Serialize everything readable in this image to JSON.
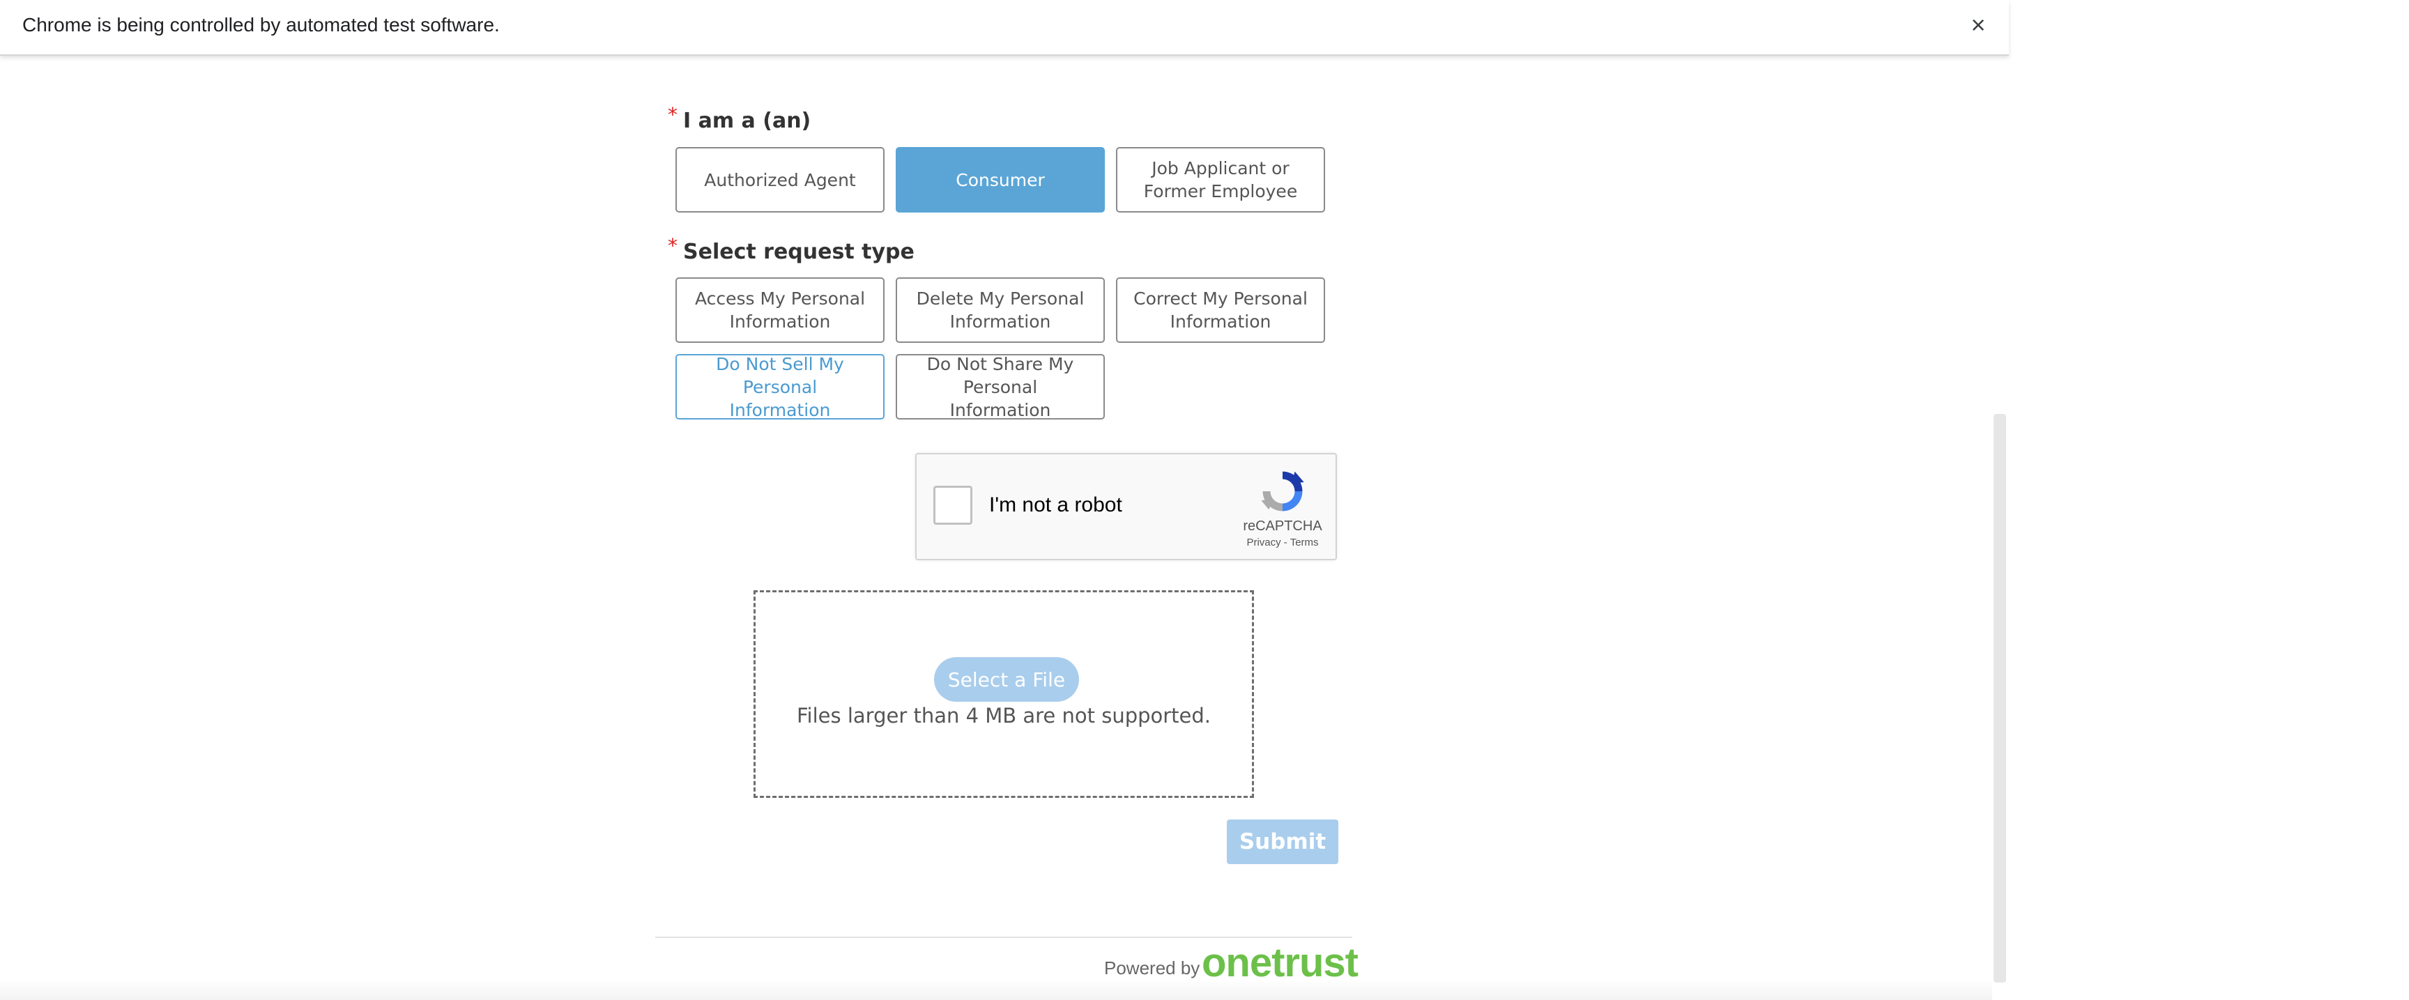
{
  "infobar": {
    "message": "Chrome is being controlled by automated test software.",
    "close_icon": "×"
  },
  "form": {
    "requester": {
      "required_mark": "*",
      "label": "I am a (an)",
      "options": [
        {
          "label": "Authorized Agent",
          "selected": false
        },
        {
          "label": "Consumer",
          "selected": true
        },
        {
          "label": "Job Applicant or Former Employee",
          "selected": false
        }
      ]
    },
    "request_type": {
      "required_mark": "*",
      "label": "Select request type",
      "options": [
        {
          "label": "Access My Personal Information",
          "selected": false
        },
        {
          "label": "Delete My Personal Information",
          "selected": false
        },
        {
          "label": "Correct My Personal Information",
          "selected": false
        },
        {
          "label": "Do Not Sell My Personal Information",
          "selected": false,
          "highlighted": true
        },
        {
          "label": "Do Not Share My Personal Information",
          "selected": false
        }
      ]
    },
    "recaptcha": {
      "label": "I'm not a robot",
      "brand": "reCAPTCHA",
      "privacy": "Privacy",
      "separator": " - ",
      "terms": "Terms",
      "checked": false
    },
    "upload": {
      "button_label": "Select a File",
      "note": "Files larger than 4 MB are not supported."
    },
    "submit_label": "Submit"
  },
  "footer": {
    "powered_by": "Powered by",
    "brand": "onetrust"
  },
  "colors": {
    "accent": "#5aa5d6",
    "accent_light": "#a9cdec",
    "required": "#e02020",
    "brand_green": "#6cc04a"
  }
}
